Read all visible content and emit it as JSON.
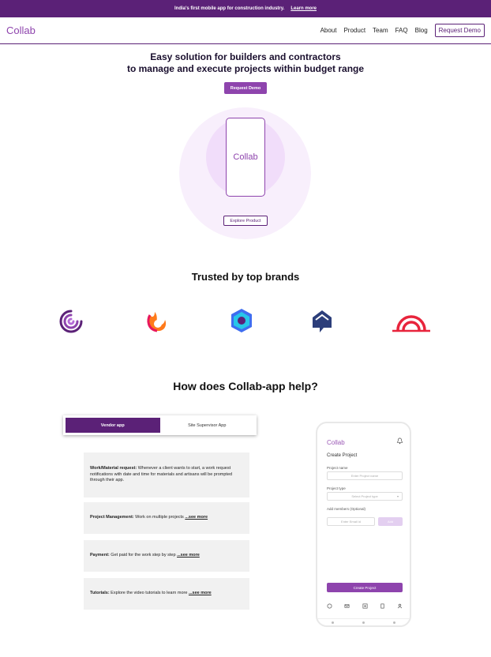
{
  "topbar": {
    "text": "India's first mobile app for construction industry.",
    "link": "Learn more"
  },
  "nav": {
    "logo": "Collab",
    "links": [
      "About",
      "Product",
      "Team",
      "FAQ",
      "Blog"
    ],
    "cta": "Request Demo"
  },
  "hero": {
    "title_line1": "Easy solution for builders and contractors",
    "title_line2": "to manage and execute projects within budget range",
    "cta": "Request Demo",
    "phone_label": "Collab",
    "explore": "Explore Product"
  },
  "brands": {
    "title": "Trusted by top brands",
    "logos": [
      "spiral-logo-icon",
      "flame-logo-icon",
      "hexagon-logo-icon",
      "house-logo-icon",
      "rainbow-logo-icon"
    ]
  },
  "help": {
    "title": "How does Collab-app help?",
    "tabs": [
      "Vendor app",
      "Site Supervisor App"
    ],
    "active_tab": "Vendor app",
    "cards": [
      {
        "title": "Work/Material request:",
        "text": " Whenever a client wants to start, a work request notifications with date and time for materials and artisans will be prompted through their app.",
        "more": ""
      },
      {
        "title": "Project Management:",
        "text": " Work on multiple projects ",
        "more": "...see more"
      },
      {
        "title": "Payment:",
        "text": " Get paid for the work step by step ",
        "more": "...see more"
      },
      {
        "title": "Tutorials:",
        "text": " Explore the video tutorials to learn more ",
        "more": "...see more"
      }
    ]
  },
  "mockup": {
    "logo": "Collab",
    "screen_title": "Create Project",
    "project_name_label": "Project name",
    "project_name_placeholder": "Enter Project name",
    "project_type_label": "Project type",
    "project_type_placeholder": "Select Project type",
    "members_label": "Add members (Optional)",
    "email_placeholder": "Enter Email id",
    "add_label": "Add",
    "create_button": "Create Project"
  },
  "colors": {
    "brand_dark": "#5b2177",
    "brand": "#8e44ad",
    "brand_light": "#f1ddfa"
  }
}
